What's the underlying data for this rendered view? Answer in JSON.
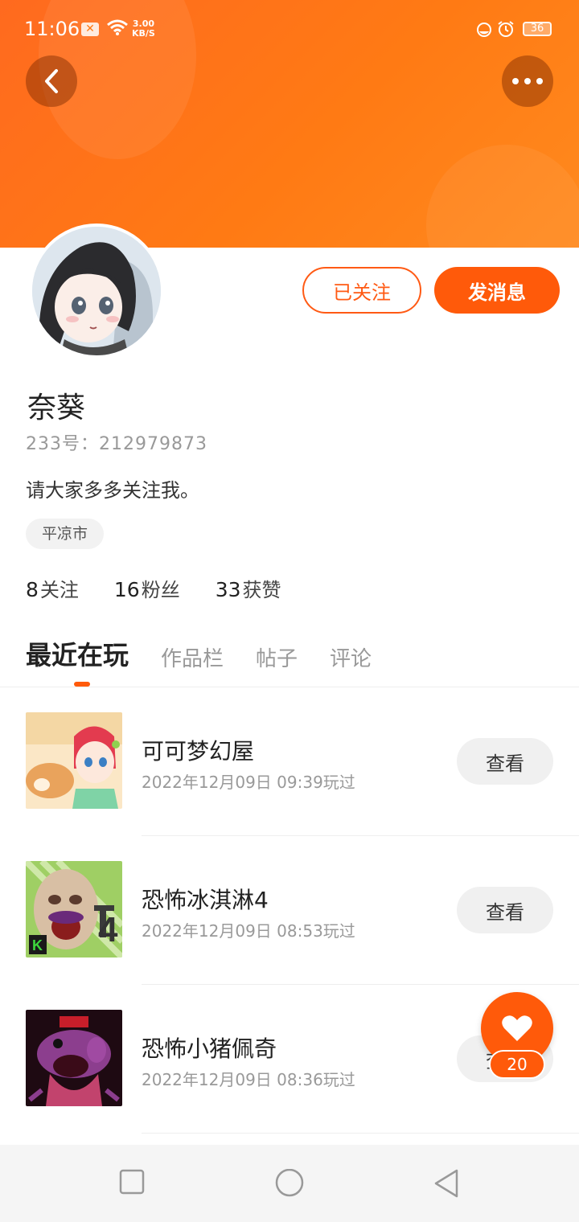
{
  "status_bar": {
    "time": "11:06",
    "speed_value": "3.00",
    "speed_unit": "KB/S",
    "battery": "36"
  },
  "header": {
    "back_icon": "chevron-left-icon",
    "more_icon": "more-dots-icon",
    "accent_color": "#ff6a1f"
  },
  "profile": {
    "follow_label": "已关注",
    "message_label": "发消息",
    "username": "奈葵",
    "user_id": "233号：212979873",
    "bio": "请大家多多关注我。",
    "location": "平凉市"
  },
  "stats": [
    {
      "value": "8",
      "label": "关注"
    },
    {
      "value": "16",
      "label": "粉丝"
    },
    {
      "value": "33",
      "label": "获赞"
    }
  ],
  "tabs": [
    "最近在玩",
    "作品栏",
    "帖子",
    "评论"
  ],
  "games": [
    {
      "name": "可可梦幻屋",
      "time": "2022年12月09日 09:39玩过",
      "button": "查看"
    },
    {
      "name": "恐怖冰淇淋4",
      "time": "2022年12月09日 08:53玩过",
      "button": "查看"
    },
    {
      "name": "恐怖小猪佩奇",
      "time": "2022年12月09日 08:36玩过",
      "button": "查看"
    }
  ],
  "like_fab": {
    "icon": "heart-icon",
    "count": "20"
  },
  "nav_bar": {
    "icons": [
      "recent-apps-icon",
      "home-icon",
      "back-triangle-icon"
    ]
  }
}
